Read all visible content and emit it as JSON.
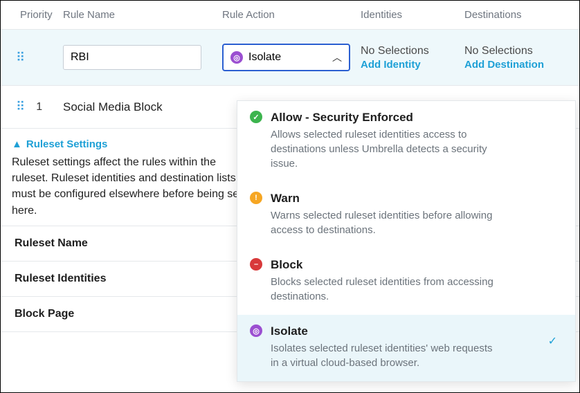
{
  "columns": {
    "priority": "Priority",
    "rule_name": "Rule Name",
    "rule_action": "Rule Action",
    "identities": "Identities",
    "destinations": "Destinations"
  },
  "editing_row": {
    "rule_name_value": "RBI",
    "selected_action": "Isolate",
    "identities_text": "No Selections",
    "identities_link": "Add Identity",
    "destinations_text": "No Selections",
    "destinations_link": "Add Destination"
  },
  "row1": {
    "priority": "1",
    "rule_name": "Social Media Block"
  },
  "action_options": [
    {
      "key": "allow",
      "title": "Allow - Security Enforced",
      "desc": "Allows selected ruleset identities access to destinations unless Umbrella detects a security issue.",
      "icon_class": "ic-allow",
      "glyph": "✓"
    },
    {
      "key": "warn",
      "title": "Warn",
      "desc": "Warns selected ruleset identities before allowing access to destinations.",
      "icon_class": "ic-warn",
      "glyph": "!"
    },
    {
      "key": "block",
      "title": "Block",
      "desc": "Blocks selected ruleset identities from accessing destinations.",
      "icon_class": "ic-block",
      "glyph": "–"
    },
    {
      "key": "isolate",
      "title": "Isolate",
      "desc": "Isolates selected ruleset identities' web requests in a virtual cloud-based browser.",
      "icon_class": "ic-isolate",
      "glyph": "◎",
      "selected": true
    }
  ],
  "settings": {
    "header": "Ruleset Settings",
    "description": "Ruleset settings affect the rules within the ruleset. Ruleset identities and destination lists must be configured elsewhere before being set here.",
    "items": [
      "Ruleset Name",
      "Ruleset Identities",
      "Block Page"
    ]
  }
}
